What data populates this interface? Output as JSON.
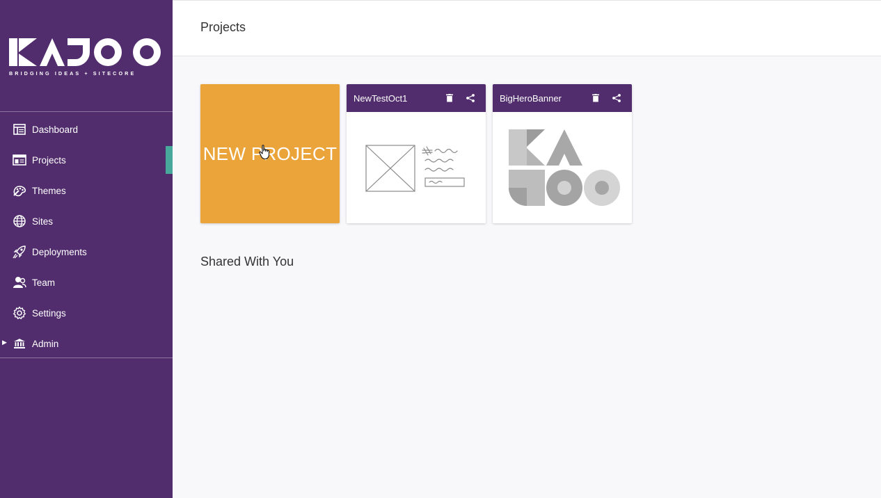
{
  "brand": {
    "logo_text": "KAJOO",
    "tagline": "BRIDGING IDEAS + SITECORE"
  },
  "sidebar": {
    "items": [
      {
        "label": "Dashboard",
        "icon": "dashboard-icon",
        "active": false
      },
      {
        "label": "Projects",
        "icon": "projects-icon",
        "active": true
      },
      {
        "label": "Themes",
        "icon": "themes-icon",
        "active": false
      },
      {
        "label": "Sites",
        "icon": "globe-icon",
        "active": false
      },
      {
        "label": "Deployments",
        "icon": "rocket-icon",
        "active": false
      },
      {
        "label": "Team",
        "icon": "team-icon",
        "active": false
      },
      {
        "label": "Settings",
        "icon": "gear-icon",
        "active": false
      },
      {
        "label": "Admin",
        "icon": "bank-icon",
        "active": false,
        "collapsed": true
      }
    ]
  },
  "header": {
    "title": "Projects"
  },
  "projects": {
    "new_label": "NEW PROJECT",
    "cards": [
      {
        "name": "NewTestOct1",
        "thumbnail": "wireframe-sketch"
      },
      {
        "name": "BigHeroBanner",
        "thumbnail": "kajoo-logo-gray"
      }
    ]
  },
  "shared": {
    "title": "Shared With You"
  },
  "colors": {
    "sidebar_bg": "#512d6d",
    "accent_active": "#49a89c",
    "new_project_bg": "#eba43a",
    "page_bg": "#f8f8fb"
  }
}
